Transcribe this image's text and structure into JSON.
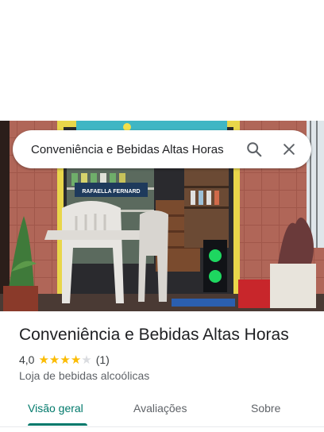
{
  "search": {
    "query": "Conveniência e Bebidas Altas Horas",
    "search_icon": "search-icon",
    "close_icon": "close-icon"
  },
  "place": {
    "name": "Conveniência e Bebidas Altas Horas",
    "rating": "4,0",
    "rating_value": 4,
    "rating_max": 5,
    "review_count": "(1)",
    "category": "Loja de bebidas alcoólicas",
    "photo_sign_text": "RAFAELLA FERNARD"
  },
  "tabs": [
    {
      "label": "Visão geral",
      "active": true
    },
    {
      "label": "Avaliações",
      "active": false
    },
    {
      "label": "Sobre",
      "active": false
    }
  ],
  "colors": {
    "accent": "#00796b",
    "star": "#fbbc04",
    "star_empty": "#dadce0"
  }
}
